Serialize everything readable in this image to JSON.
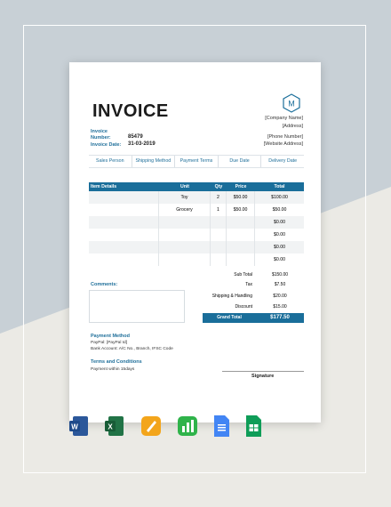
{
  "invoice": {
    "title": "INVOICE",
    "logo_letter": "M",
    "company": {
      "name": "[Company Name]",
      "address": "[Address]",
      "phone": "[Phone Number]",
      "website": "[Website Address]"
    },
    "number_label_1": "Invoice",
    "number_label_2": "Number:",
    "number_value": "85479",
    "date_label": "Invoice Date:",
    "date_value": "31-03-2019",
    "sales_headers": [
      "Sales Person",
      "Shipping Method",
      "Payment Terms",
      "Due Date",
      "Delivery Date"
    ],
    "table_headers": [
      "Item Details",
      "Unit",
      "Qty",
      "Price",
      "Total"
    ],
    "rows": [
      {
        "item": "",
        "unit": "Toy",
        "qty": "2",
        "price": "$50.00",
        "total": "$100.00"
      },
      {
        "item": "",
        "unit": "Grocery",
        "qty": "1",
        "price": "$50.00",
        "total": "$50.00"
      },
      {
        "item": "",
        "unit": "",
        "qty": "",
        "price": "",
        "total": "$0.00"
      },
      {
        "item": "",
        "unit": "",
        "qty": "",
        "price": "",
        "total": "$0.00"
      },
      {
        "item": "",
        "unit": "",
        "qty": "",
        "price": "",
        "total": "$0.00"
      },
      {
        "item": "",
        "unit": "",
        "qty": "",
        "price": "",
        "total": "$0.00"
      }
    ],
    "summary": [
      {
        "label": "Sub Total",
        "value": "$150.00"
      },
      {
        "label": "Tax",
        "value": "$7.50"
      },
      {
        "label": "Shipping & Handling",
        "value": "$20.00"
      },
      {
        "label": "Discount",
        "value": "$15.00"
      }
    ],
    "grand_total_label": "Grand Total",
    "grand_total_value": "$177.50",
    "comments_label": "Comments:",
    "payment_label": "Payment Method",
    "payment_line1": "PayPal: [PayPal Id]",
    "payment_line2": "Bank Account: A/C No., Branch, IFSC Code",
    "terms_label": "Terms and Conditions",
    "terms_text": "Payment within 15days",
    "signature_label": "Signature"
  },
  "colors": {
    "accent": "#1a6e9a",
    "background": "#ebeae5",
    "background_top": "#c8d0d6"
  },
  "format_icons": [
    "word-icon",
    "excel-icon",
    "pages-icon",
    "numbers-icon",
    "google-docs-icon",
    "google-sheets-icon"
  ]
}
